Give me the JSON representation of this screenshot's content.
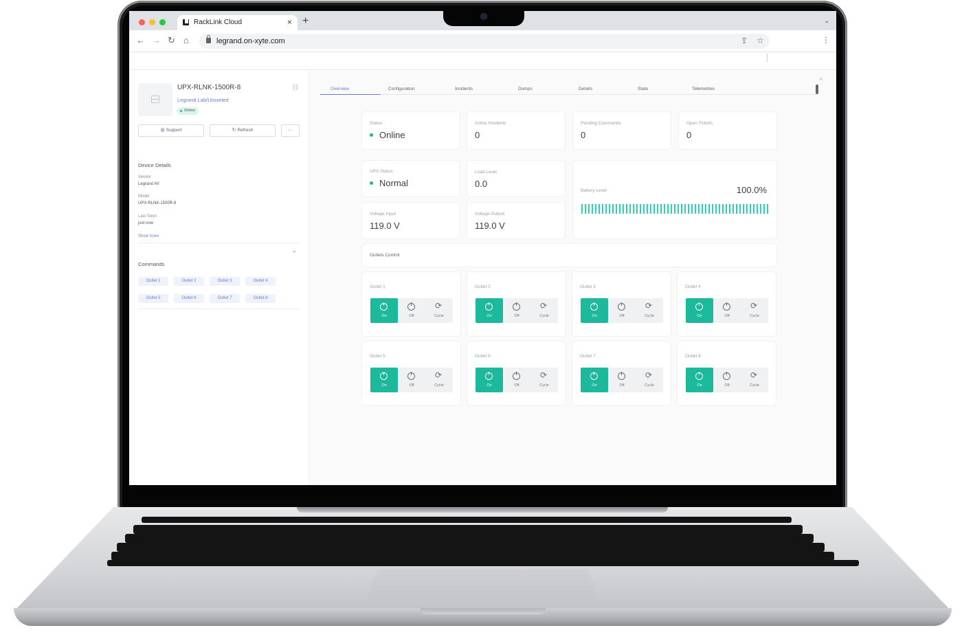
{
  "browser": {
    "tab_title": "RackLink Cloud",
    "tab_close": "×",
    "new_tab": "+",
    "url": "legrand.on-xyte.com",
    "nav": {
      "back": "←",
      "forward": "→",
      "reload": "↻",
      "home": "⌂"
    },
    "share": "⇪",
    "bookmark_star": "☆",
    "menu": "⋮",
    "tab_menu": "⌄",
    "traffic_lights": [
      "#ff5f57",
      "#febc2e",
      "#28c840"
    ]
  },
  "device": {
    "name": "UPX-RLNK-1500R-8",
    "path": "Legrand Lab/Unsorted",
    "status": "Online",
    "link_icon": "⛓",
    "actions": {
      "support": "Support",
      "refresh": "Refresh",
      "more": "···"
    }
  },
  "details": {
    "title": "Device Details",
    "vendor_label": "Vendor",
    "vendor": "Legrand AV",
    "model_label": "Model",
    "model": "UPX-RLNK-1500R-8",
    "last_seen_label": "Last Seen",
    "last_seen": "just now",
    "show_more": "Show more"
  },
  "commands": {
    "title": "Commands",
    "chevron": "⌃",
    "items": [
      "Outlet 1",
      "Outlet 2",
      "Outlet 3",
      "Outlet 4",
      "Outlet 5",
      "Outlet 6",
      "Outlet 7",
      "Outlet 8"
    ]
  },
  "tabs": [
    "Overview",
    "Configuration",
    "Incidents",
    "Dumps",
    "Details",
    "State",
    "Telemetries"
  ],
  "active_tab": "Overview",
  "close": "×",
  "summary": {
    "status_label": "Status",
    "status": "Online",
    "incidents_label": "Active Incidents",
    "incidents": "0",
    "pending_label": "Pending Commands",
    "pending": "0",
    "tickets_label": "Open Tickets",
    "tickets": "0"
  },
  "telemetry": {
    "ups_label": "UPS Status",
    "ups": "Normal",
    "load_label": "Load Level",
    "load": "0.0",
    "vin_label": "Voltage Input",
    "vin": "119.0 V",
    "vout_label": "Voltage Output",
    "vout": "119.0 V",
    "battery_label": "Battery Level",
    "battery": "100.0%",
    "battery_fraction": 1.0
  },
  "outlets_title": "Outlets Control",
  "outlet_buttons": {
    "on": "On",
    "off": "Off",
    "cycle": "Cycle"
  },
  "outlets": [
    {
      "name": "Outlet 1",
      "state": "on"
    },
    {
      "name": "Outlet 2",
      "state": "on"
    },
    {
      "name": "Outlet 3",
      "state": "on"
    },
    {
      "name": "Outlet 4",
      "state": "on"
    },
    {
      "name": "Outlet 5",
      "state": "on"
    },
    {
      "name": "Outlet 6",
      "state": "on"
    },
    {
      "name": "Outlet 7",
      "state": "on"
    },
    {
      "name": "Outlet 8",
      "state": "on"
    }
  ],
  "colors": {
    "accent": "#1db99c",
    "link": "#6a79d8",
    "online": "#1cb59a"
  }
}
